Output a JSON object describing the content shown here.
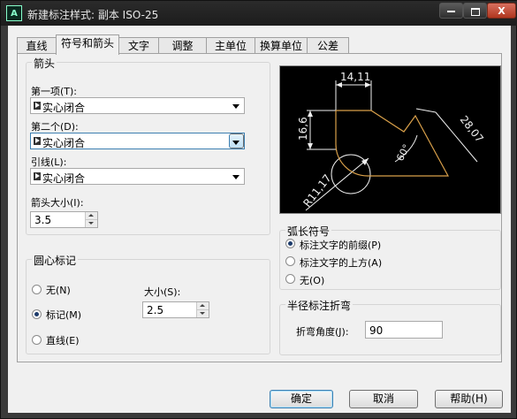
{
  "window": {
    "title": "新建标注样式: 副本 ISO-25",
    "icon_label": "A",
    "minimize_label": "",
    "maximize_label": "",
    "close_label": "X"
  },
  "tabs": [
    {
      "label": "直线"
    },
    {
      "label": "符号和箭头"
    },
    {
      "label": "文字"
    },
    {
      "label": "调整"
    },
    {
      "label": "主单位"
    },
    {
      "label": "换算单位"
    },
    {
      "label": "公差"
    }
  ],
  "arrowheads": {
    "title": "箭头",
    "first_label": "第一项(T):",
    "first_value": "实心闭合",
    "second_label": "第二个(D):",
    "second_value": "实心闭合",
    "leader_label": "引线(L):",
    "leader_value": "实心闭合",
    "size_label": "箭头大小(I):",
    "size_value": "3.5"
  },
  "center_marks": {
    "title": "圆心标记",
    "none_label": "无(N)",
    "mark_label": "标记(M)",
    "line_label": "直线(E)",
    "selected": "mark",
    "size_label": "大小(S):",
    "size_value": "2.5"
  },
  "preview": {
    "dim_top": "14,11",
    "dim_left": "16,6",
    "dim_right": "28,07",
    "dim_angle": "60°",
    "dim_radius": "R11,17"
  },
  "arc_length": {
    "title": "弧长符号",
    "prefix_label": "标注文字的前缀(P)",
    "above_label": "标注文字的上方(A)",
    "none_label": "无(O)",
    "selected": "prefix"
  },
  "radius_jog": {
    "title": "半径标注折弯",
    "angle_label": "折弯角度(J):",
    "angle_value": "90"
  },
  "buttons": {
    "ok": "确定",
    "cancel": "取消",
    "help": "帮助(H)"
  }
}
